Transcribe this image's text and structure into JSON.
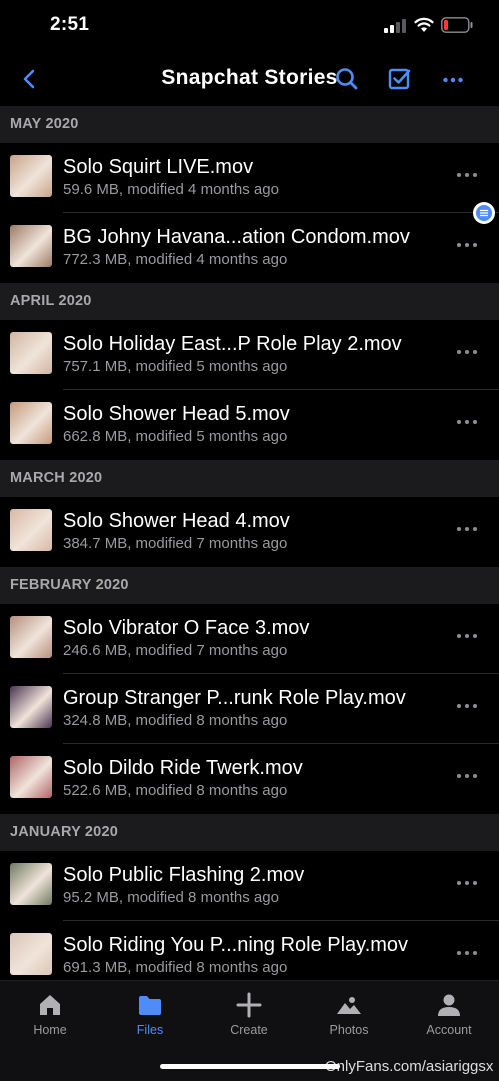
{
  "status_bar": {
    "time": "2:51"
  },
  "nav": {
    "title": "Snapchat Stories"
  },
  "sections": [
    {
      "header": "MAY 2020",
      "items": [
        {
          "name": "Solo Squirt LIVE.mov",
          "meta": "59.6 MB, modified 4 months ago",
          "thumb": "#c8a38a"
        },
        {
          "name": "BG Johny Havana...ation Condom.mov",
          "meta": "772.3 MB, modified 4 months ago",
          "thumb": "#9c7b66"
        }
      ]
    },
    {
      "header": "APRIL 2020",
      "items": [
        {
          "name": "Solo Holiday East...P Role Play 2.mov",
          "meta": "757.1 MB, modified 5 months ago",
          "thumb": "#d1b5a0"
        },
        {
          "name": "Solo Shower Head 5.mov",
          "meta": "662.8 MB, modified 5 months ago",
          "thumb": "#c49a7c"
        }
      ]
    },
    {
      "header": "MARCH 2020",
      "items": [
        {
          "name": "Solo Shower Head 4.mov",
          "meta": "384.7 MB, modified 7 months ago",
          "thumb": "#d8b8a4"
        }
      ]
    },
    {
      "header": "FEBRUARY 2020",
      "items": [
        {
          "name": "Solo Vibrator O Face 3.mov",
          "meta": "246.6 MB, modified 7 months ago",
          "thumb": "#b58f7d"
        },
        {
          "name": "Group Stranger P...runk Role Play.mov",
          "meta": "324.8 MB, modified 8 months ago",
          "thumb": "#4a3350"
        },
        {
          "name": "Solo Dildo Ride Twerk.mov",
          "meta": "522.6 MB, modified 8 months ago",
          "thumb": "#b06468"
        }
      ]
    },
    {
      "header": "JANUARY 2020",
      "items": [
        {
          "name": "Solo Public Flashing 2.mov",
          "meta": "95.2 MB, modified 8 months ago",
          "thumb": "#6f7a60"
        },
        {
          "name": "Solo Riding You P...ning Role Play.mov",
          "meta": "691.3 MB, modified 8 months ago",
          "thumb": "#d9c6b6"
        }
      ]
    }
  ],
  "tabs": [
    {
      "label": "Home",
      "icon": "home-icon",
      "active": false
    },
    {
      "label": "Files",
      "icon": "folder-icon",
      "active": true
    },
    {
      "label": "Create",
      "icon": "plus-icon",
      "active": false
    },
    {
      "label": "Photos",
      "icon": "photos-icon",
      "active": false
    },
    {
      "label": "Account",
      "icon": "account-icon",
      "active": false
    }
  ],
  "watermark": "OnlyFans.com/asiariggsx",
  "colors": {
    "accent": "#4e8cf7",
    "background": "#000000",
    "section_bg": "#1b1b1d",
    "battery_low": "#ff3b30"
  }
}
